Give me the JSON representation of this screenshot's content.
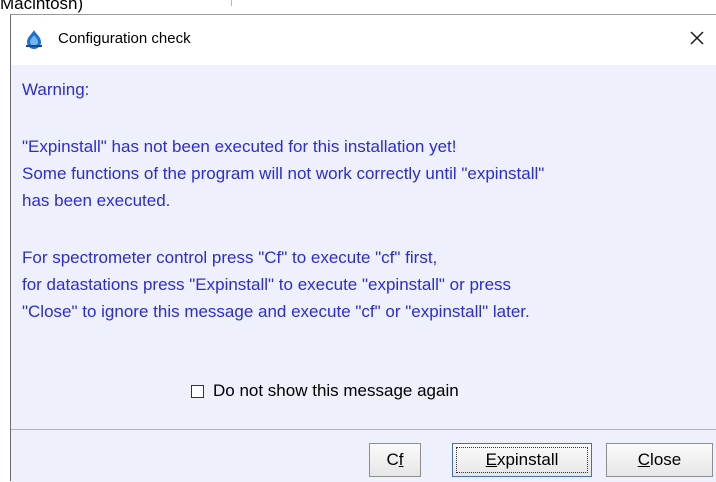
{
  "background": {
    "partial_text": "Macintosh)"
  },
  "dialog": {
    "title": "Configuration check",
    "icon": "bruker-app-icon",
    "close_icon": "close-icon",
    "message_lines": [
      "Warning:",
      "\"Expinstall\" has not been executed for this installation yet!",
      "Some functions of the program will not work correctly until \"expinstall\"",
      "has been executed.",
      "For spectrometer control press \"Cf\" to execute \"cf\" first,",
      "for datastations press \"Expinstall\" to execute \"expinstall\" or press",
      "\"Close\" to ignore this message and execute \"cf\" or \"expinstall\" later."
    ],
    "checkbox": {
      "label": "Do not show this message again",
      "checked": false
    },
    "buttons": {
      "cf": {
        "pre": "C",
        "mnemonic": "f",
        "post": ""
      },
      "expinstall": {
        "pre": "",
        "mnemonic": "E",
        "post": "xpinstall"
      },
      "close": {
        "pre": "",
        "mnemonic": "C",
        "post": "lose"
      }
    }
  },
  "colors": {
    "message_text": "#2b2bd8",
    "content_background": "#eef1fb",
    "focused_button_border": "#4a6fb0"
  }
}
